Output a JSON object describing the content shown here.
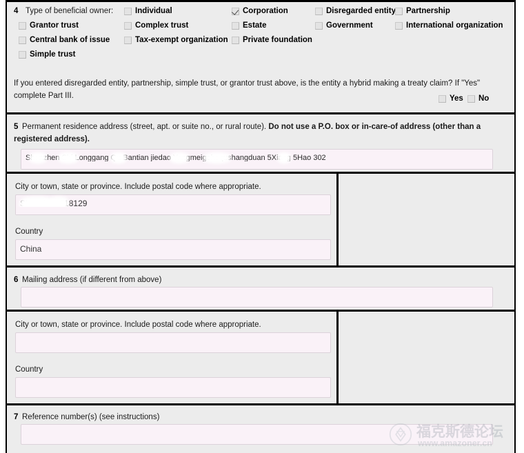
{
  "form": {
    "watermark": {
      "text_cn": "福克斯德论坛",
      "url": "www.amazoner.cn",
      "logo_icon": "diamond-logo-icon"
    }
  },
  "line4": {
    "number": "4",
    "prompt": "Type of beneficial owner:",
    "options": [
      {
        "label": "Individual",
        "checked": false,
        "col": 1,
        "row": 1
      },
      {
        "label": "Corporation",
        "checked": true,
        "col": 2,
        "row": 1
      },
      {
        "label": "Disregarded entity",
        "checked": false,
        "col": 3,
        "row": 1
      },
      {
        "label": "Partnership",
        "checked": false,
        "col": 4,
        "row": 1
      },
      {
        "label": "Grantor trust",
        "checked": false,
        "col": 0,
        "row": 2
      },
      {
        "label": "Complex trust",
        "checked": false,
        "col": 1,
        "row": 2
      },
      {
        "label": "Estate",
        "checked": false,
        "col": 2,
        "row": 2
      },
      {
        "label": "Government",
        "checked": false,
        "col": 3,
        "row": 2
      },
      {
        "label": "International organization",
        "checked": false,
        "col": 4,
        "row": 2
      },
      {
        "label": "Central bank of issue",
        "checked": false,
        "col": 0,
        "row": 3
      },
      {
        "label": "Tax-exempt organization",
        "checked": false,
        "col": 1,
        "row": 3
      },
      {
        "label": "Private foundation",
        "checked": false,
        "col": 2,
        "row": 3
      },
      {
        "label": "Simple trust",
        "checked": false,
        "col": 0,
        "row": 4
      }
    ],
    "hybrid_question": "If you entered disregarded entity, partnership, simple trust, or grantor trust above, is the entity a hybrid making a treaty claim? If \"Yes\" complete Part III.",
    "yes_label": "Yes",
    "yes_checked": false,
    "no_label": "No",
    "no_checked": false
  },
  "line5": {
    "number": "5",
    "prompt_normal": "Permanent residence address (street, apt. or suite no., or rural route). ",
    "prompt_bold": "Do not use a P.O. box or in-care-of address (other than a registered address).",
    "street_value": "Shenzhen Shi Longgang Qu Bantian jiedao Yangmeigehequshangduan 5Xiang 5Hao 302",
    "street_placeholder": "",
    "city_label": "City or town, state or province. Include postal code where appropriate.",
    "city_value": "Shenzhen 518129",
    "country_label": "Country",
    "country_value": "China"
  },
  "line6": {
    "number": "6",
    "prompt": "Mailing address (if different from above)",
    "street_value": "",
    "city_label": "City or town, state or province. Include postal code where appropriate.",
    "city_value": "",
    "country_label": "Country",
    "country_value": ""
  },
  "line7": {
    "number": "7",
    "prompt": "Reference number(s) (see instructions)",
    "value": ""
  }
}
